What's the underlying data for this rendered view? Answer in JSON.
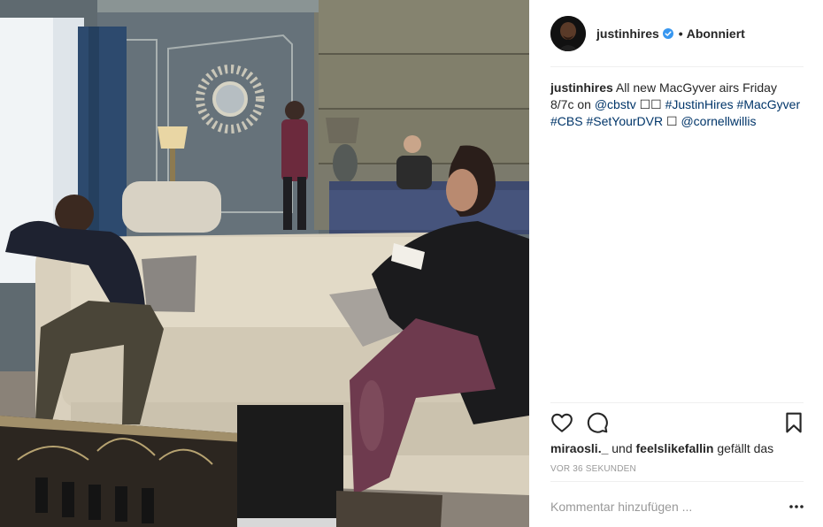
{
  "post": {
    "photo_alt": "",
    "header": {
      "username": "justinhires",
      "verified_icon": "verified-badge-icon",
      "separator": "•",
      "follow_state": "Abonniert"
    },
    "caption": {
      "username": "justinhires",
      "text_1": "All new MacGyver airs Friday 8/7c on",
      "mention_1": "@cbstv",
      "emoji": "☐☐",
      "hashtags": [
        "#JustinHires",
        "#MacGyver",
        "#CBS",
        "#SetYourDVR"
      ],
      "emoji_2": "☐",
      "mention_2": "@cornellwillis"
    },
    "actions": {
      "like_icon": "heart-icon",
      "comment_icon": "comment-bubble-icon",
      "save_icon": "bookmark-icon"
    },
    "likes": {
      "user_1": "miraosli._",
      "conjunction": "und",
      "user_2": "feelslikefallin",
      "suffix": "gefällt das"
    },
    "timestamp": "VOR 36 SEKUNDEN",
    "comment": {
      "placeholder": "Kommentar hinzufügen ...",
      "more_icon": "more-options-icon"
    }
  },
  "colors": {
    "text": "#262626",
    "link": "#003569",
    "muted": "#999999",
    "verified": "#3897f0",
    "divider": "#efefef"
  }
}
